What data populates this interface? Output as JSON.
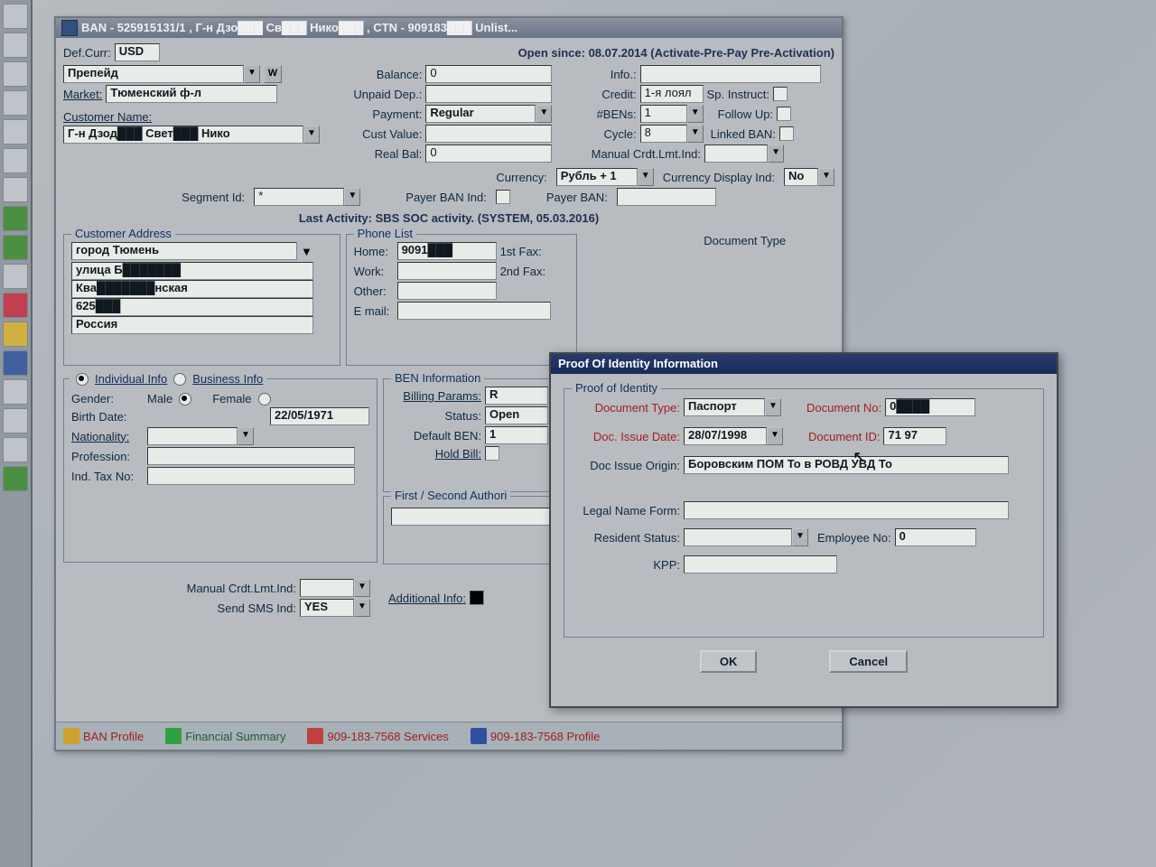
{
  "window": {
    "title": "BAN - 525915131/1 , Г-н Дзо███ Св███ Нико███ , CTN - 909183███  Unlist...",
    "def_curr_lbl": "Def.Curr:",
    "def_curr": "USD",
    "open_since": "Open since: 08.07.2014 (Activate-Pre-Pay Pre-Activation)",
    "plan": "Препейд",
    "w": "W",
    "market_lbl": "Market:",
    "market": "Тюменский ф-л",
    "cust_name_lbl": "Customer Name:",
    "cust_name": "Г-н Дзод███ Свет███ Нико",
    "balance_lbl": "Balance:",
    "balance": "0",
    "unpaid_lbl": "Unpaid Dep.:",
    "unpaid": "",
    "payment_lbl": "Payment:",
    "payment": "Regular",
    "custvalue_lbl": "Cust Value:",
    "realbal_lbl": "Real Bal:",
    "realbal": "0",
    "info_lbl": "Info.:",
    "credit_lbl": "Credit:",
    "credit": "1-я лоял",
    "sp_instruct_lbl": "Sp. Instruct:",
    "bens_lbl": "#BENs:",
    "bens": "1",
    "followup_lbl": "Follow Up:",
    "cycle_lbl": "Cycle:",
    "cycle": "8",
    "linked_lbl": "Linked BAN:",
    "manual_cli_lbl": "Manual Crdt.Lmt.Ind:",
    "currency_lbl": "Currency:",
    "currency": "Рубль + 1",
    "curr_disp_lbl": "Currency Display Ind:",
    "curr_disp": "No",
    "segment_lbl": "Segment Id:",
    "segment": "*",
    "payer_ban_ind_lbl": "Payer BAN Ind:",
    "payer_ban_lbl": "Payer BAN:",
    "last_activity": "Last Activity: SBS SOC activity. (SYSTEM, 05.03.2016)"
  },
  "address": {
    "legend": "Customer Address",
    "line1": "город Тюмень",
    "line2": "улица Б███████",
    "line3": "  Ква███████нская",
    "line4": "625███",
    "line5": "Россия"
  },
  "phone": {
    "legend": "Phone List",
    "home_lbl": "Home:",
    "home": "9091███",
    "work_lbl": "Work:",
    "other_lbl": "Other:",
    "email_lbl": "E mail:",
    "fax1_lbl": "1st Fax:",
    "fax2_lbl": "2nd Fax:"
  },
  "doctype_lbl": "Document Type",
  "info": {
    "indiv_lbl": "Individual Info",
    "biz_lbl": "Business Info",
    "gender_lbl": "Gender:",
    "male": "Male",
    "female": "Female",
    "birth_lbl": "Birth Date:",
    "birth": "22/05/1971",
    "nat_lbl": "Nationality:",
    "prof_lbl": "Profession:",
    "tax_lbl": "Ind. Tax No:"
  },
  "ben": {
    "legend": "BEN Information",
    "billing_lbl": "Billing Params:",
    "billing": "R",
    "status_lbl": "Status:",
    "status": "Open",
    "default_lbl": "Default BEN:",
    "default": "1",
    "hold_lbl": "Hold Bill:"
  },
  "auth_legend": "First / Second  Authori",
  "bottom": {
    "manual_lbl": "Manual Crdt.Lmt.Ind:",
    "sms_lbl": "Send SMS Ind:",
    "sms": "YES",
    "addl_lbl": "Additional Info:"
  },
  "tabs": {
    "ban": "BAN Profile",
    "fin": "Financial Summary",
    "svc": "909-183-7568 Services",
    "prof": "909-183-7568 Profile"
  },
  "popup": {
    "title": "Proof Of Identity Information",
    "legend": "Proof of Identity",
    "doctype_lbl": "Document Type:",
    "doctype": "Паспорт",
    "docno_lbl": "Document No:",
    "docno": "0████",
    "issue_lbl": "Doc. Issue Date:",
    "issue": "28/07/1998",
    "docid_lbl": "Document ID:",
    "docid": "71 97",
    "origin_lbl": "Doc Issue Origin:",
    "origin": "Боровским ПОМ То в РОВД УВД То",
    "legal_lbl": "Legal Name Form:",
    "resident_lbl": "Resident Status:",
    "emp_lbl": "Employee No:",
    "emp": "0",
    "kpp_lbl": "KPP:",
    "ok": "OK",
    "cancel": "Cancel"
  }
}
